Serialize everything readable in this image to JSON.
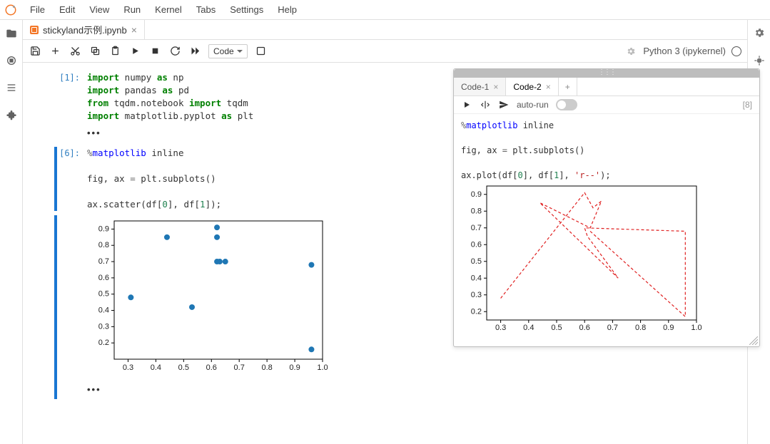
{
  "menu": {
    "file": "File",
    "edit": "Edit",
    "view": "View",
    "run": "Run",
    "kernel": "Kernel",
    "tabs": "Tabs",
    "settings": "Settings",
    "help": "Help"
  },
  "tab": {
    "title": "stickyland示例.ipynb"
  },
  "toolbar": {
    "cellType": "Code"
  },
  "kernel": {
    "name": "Python 3 (ipykernel)"
  },
  "cell1": {
    "prompt": "[1]:",
    "code": "import numpy as np\nimport pandas as pd\nfrom tqdm.notebook import tqdm\nimport matplotlib.pyplot as plt"
  },
  "cell2": {
    "prompt": "[6]:",
    "code": "%matplotlib inline\n\nfig, ax = plt.subplots()\n\nax.scatter(df[0], df[1]);"
  },
  "sticky": {
    "tabs": {
      "code1": "Code-1",
      "code2": "Code-2"
    },
    "autorun": "auto-run",
    "count": "[8]",
    "code": "%matplotlib inline\n\nfig, ax = plt.subplots()\n\nax.plot(df[0], df[1], 'r--');"
  },
  "chart_data": [
    {
      "type": "scatter",
      "title": "",
      "xlabel": "",
      "ylabel": "",
      "xlim": [
        0.25,
        1.0
      ],
      "ylim": [
        0.1,
        0.95
      ],
      "xticks": [
        0.3,
        0.4,
        0.5,
        0.6,
        0.7,
        0.8,
        0.9,
        1.0
      ],
      "yticks": [
        0.2,
        0.3,
        0.4,
        0.5,
        0.6,
        0.7,
        0.8,
        0.9
      ],
      "x": [
        0.31,
        0.44,
        0.53,
        0.62,
        0.62,
        0.62,
        0.63,
        0.65,
        0.96,
        0.96
      ],
      "y": [
        0.48,
        0.85,
        0.42,
        0.91,
        0.85,
        0.7,
        0.7,
        0.7,
        0.68,
        0.16
      ]
    },
    {
      "type": "line",
      "title": "",
      "xlabel": "",
      "ylabel": "",
      "xlim": [
        0.25,
        1.0
      ],
      "ylim": [
        0.15,
        0.95
      ],
      "xticks": [
        0.3,
        0.4,
        0.5,
        0.6,
        0.7,
        0.8,
        0.9,
        1.0
      ],
      "yticks": [
        0.2,
        0.3,
        0.4,
        0.5,
        0.6,
        0.7,
        0.8,
        0.9
      ],
      "style": "r--",
      "x": [
        0.3,
        0.6,
        0.63,
        0.66,
        0.62,
        0.44,
        0.72,
        0.61,
        0.6,
        0.96,
        0.96,
        0.62
      ],
      "y": [
        0.28,
        0.91,
        0.82,
        0.86,
        0.7,
        0.85,
        0.4,
        0.65,
        0.7,
        0.68,
        0.17,
        0.68
      ]
    }
  ]
}
